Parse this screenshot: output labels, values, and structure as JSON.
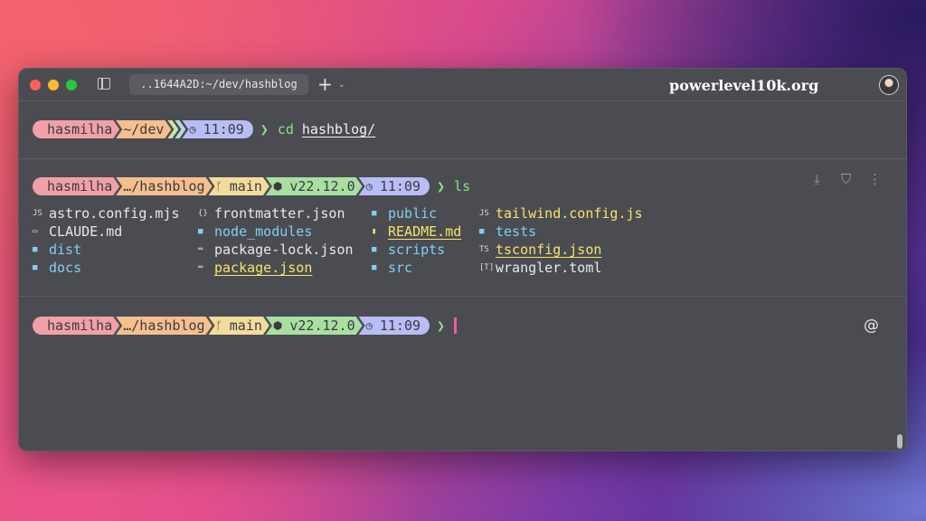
{
  "window": {
    "tab_title": "..1644A2D:~/dev/hashblog",
    "brand": "powerlevel10k.org",
    "new_tab_symbol": "+",
    "tab_menu_symbol": "⌄"
  },
  "prompt1": {
    "user": "hasmilha",
    "dir": "~/dev",
    "time": "11:09",
    "caret": "❯",
    "command": "cd",
    "arg": "hashblog/"
  },
  "prompt2": {
    "user": "hasmilha",
    "dir": "…/hashblog",
    "branch": "main",
    "node": "v22.12.0",
    "time": "11:09",
    "caret": "❯",
    "command": "ls"
  },
  "ls_output": {
    "col1": [
      {
        "icon": "JS",
        "name": "astro.config.mjs"
      },
      {
        "icon": "▭",
        "name": "CLAUDE.md"
      },
      {
        "icon": "■",
        "name": "dist"
      },
      {
        "icon": "■",
        "name": "docs"
      }
    ],
    "col2": [
      {
        "icon": "{}",
        "name": "frontmatter.json"
      },
      {
        "icon": "■",
        "name": "node_modules"
      },
      {
        "icon": "═",
        "name": "package-lock.json"
      },
      {
        "icon": "═",
        "name": "package.json"
      }
    ],
    "col3": [
      {
        "icon": "■",
        "name": "public"
      },
      {
        "icon": "▮",
        "name": "README.md"
      },
      {
        "icon": "■",
        "name": "scripts"
      },
      {
        "icon": "■",
        "name": "src"
      }
    ],
    "col4": [
      {
        "icon": "JS",
        "name": "tailwind.config.js"
      },
      {
        "icon": "■",
        "name": "tests"
      },
      {
        "icon": "TS",
        "name": "tsconfig.json"
      },
      {
        "icon": "[T]",
        "name": "wrangler.toml"
      }
    ]
  },
  "prompt3": {
    "user": "hasmilha",
    "dir": "…/hashblog",
    "branch": "main",
    "node": "v22.12.0",
    "time": "11:09",
    "caret": "❯"
  },
  "icons": {
    "apple": "",
    "clock": "◷",
    "branch": "ᚴ",
    "node": "⬢",
    "at": "@",
    "download": "⤓",
    "filter": "⛉",
    "more": "⋮"
  },
  "colors": {
    "user_seg": "#f2a0a8",
    "dir_seg": "#f5bf8e",
    "git_seg": "#f3dc9b",
    "node_seg": "#a7e0a0",
    "time_seg": "#b9bdf5",
    "dir_text": "#7fd0f0",
    "highlight_text": "#f5e46a",
    "command_green": "#8be08f"
  }
}
